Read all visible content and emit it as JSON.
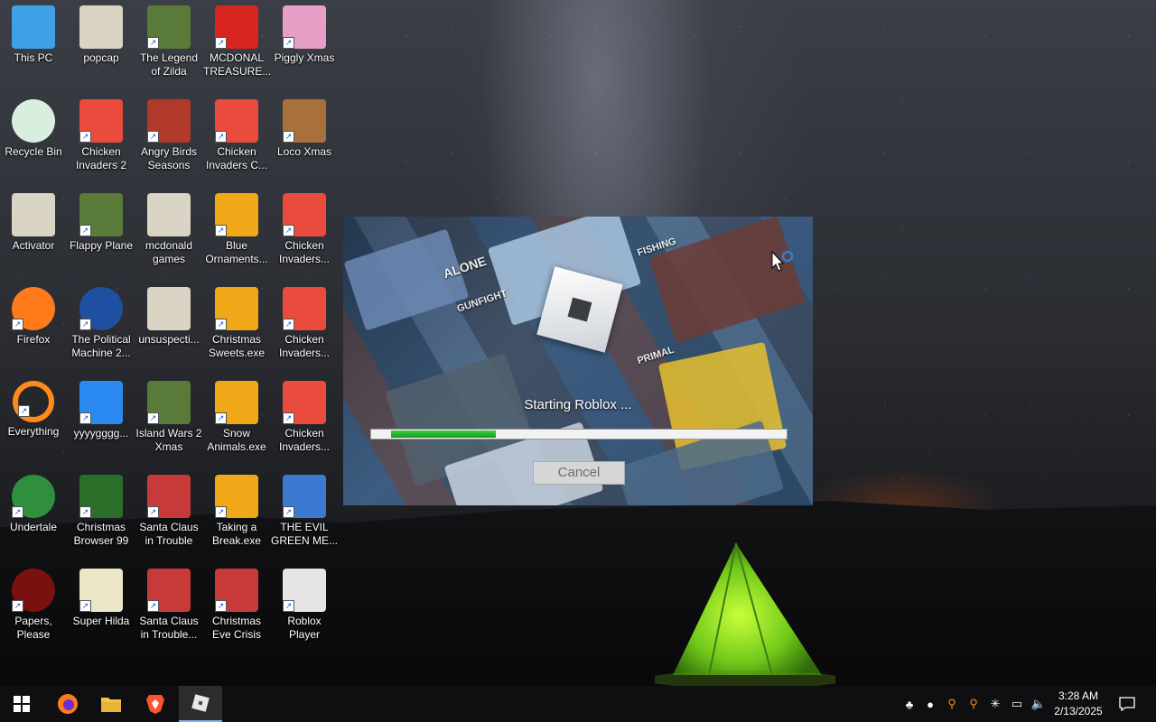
{
  "desktop": {
    "icons": [
      {
        "label": "This PC",
        "icon": "computer-icon"
      },
      {
        "label": "popcap",
        "icon": "folder-icon"
      },
      {
        "label": "The Legend of Zilda",
        "icon": "game-icon"
      },
      {
        "label": "MCDONAL TREASURE...",
        "icon": "mcdonalds-icon"
      },
      {
        "label": "Piggly Xmas",
        "icon": "pig-icon"
      },
      {
        "label": "Recycle Bin",
        "icon": "recycle-bin-icon"
      },
      {
        "label": "Chicken Invaders 2",
        "icon": "chicken-icon"
      },
      {
        "label": "Angry Birds Seasons",
        "icon": "angry-birds-icon"
      },
      {
        "label": "Chicken Invaders C...",
        "icon": "chicken-icon"
      },
      {
        "label": "Loco Xmas",
        "icon": "bear-icon"
      },
      {
        "label": "Activator",
        "icon": "folder-icon"
      },
      {
        "label": "Flappy Plane",
        "icon": "game-icon"
      },
      {
        "label": "mcdonald games",
        "icon": "folder-icon"
      },
      {
        "label": "Blue Ornaments...",
        "icon": "installer-icon"
      },
      {
        "label": "Chicken Invaders...",
        "icon": "chicken-icon"
      },
      {
        "label": "Firefox",
        "icon": "firefox-icon"
      },
      {
        "label": "The Political Machine 2...",
        "icon": "political-icon"
      },
      {
        "label": "unsuspecti...",
        "icon": "folder-icon"
      },
      {
        "label": "Christmas Sweets.exe",
        "icon": "installer-icon"
      },
      {
        "label": "Chicken Invaders...",
        "icon": "chicken-icon"
      },
      {
        "label": "Everything",
        "icon": "search-icon"
      },
      {
        "label": "yyyygggg...",
        "icon": "roblox-studio-icon"
      },
      {
        "label": "Island Wars 2 Xmas",
        "icon": "game-icon"
      },
      {
        "label": "Snow Animals.exe",
        "icon": "installer-icon"
      },
      {
        "label": "Chicken Invaders...",
        "icon": "chicken-icon"
      },
      {
        "label": "Undertale",
        "icon": "undertale-icon"
      },
      {
        "label": "Christmas Browser 99",
        "icon": "tree-icon"
      },
      {
        "label": "Santa Claus in Trouble",
        "icon": "santa-icon"
      },
      {
        "label": "Taking a Break.exe",
        "icon": "installer-icon"
      },
      {
        "label": "THE EVIL GREEN ME...",
        "icon": "messenger-icon"
      },
      {
        "label": "Papers, Please",
        "icon": "papers-icon"
      },
      {
        "label": "Super Hilda",
        "icon": "pixel-icon"
      },
      {
        "label": "Santa Claus in Trouble...",
        "icon": "santa-icon"
      },
      {
        "label": "Christmas Eve Crisis",
        "icon": "santa-icon"
      },
      {
        "label": "Roblox Player",
        "icon": "roblox-icon"
      }
    ]
  },
  "splash": {
    "status": "Starting Roblox ...",
    "cancel_label": "Cancel",
    "progress": 0.28,
    "bg_labels": [
      "ALONE",
      "GUNFIGHT",
      "FISHING",
      "PRIMAL"
    ]
  },
  "taskbar": {
    "pinned": [
      {
        "name": "start-button",
        "icon": "windows-icon"
      },
      {
        "name": "firefox-taskbar-button",
        "icon": "firefox-icon"
      },
      {
        "name": "file-explorer-taskbar-button",
        "icon": "folder-icon"
      },
      {
        "name": "brave-taskbar-button",
        "icon": "brave-icon"
      },
      {
        "name": "roblox-taskbar-button",
        "icon": "roblox-icon"
      }
    ],
    "clock": {
      "time": "3:28 AM",
      "date": "2/13/2025"
    }
  },
  "colors": {
    "progress": "#1aa82a",
    "taskbar": "#101012",
    "accent": "#7ab2ea"
  }
}
